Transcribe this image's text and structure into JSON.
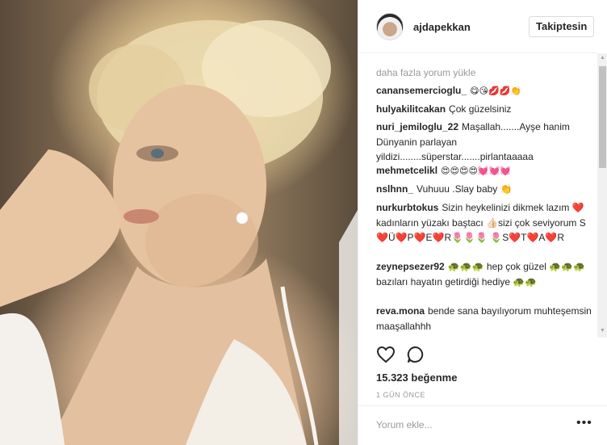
{
  "post": {
    "username": "ajdapekkan",
    "follow_label": "Takiptesin",
    "load_more": "daha fazla yorum yükle",
    "comments": [
      {
        "user": "canansemercioglu_",
        "text": "😋😘💋💋👏"
      },
      {
        "user": "hulyakilitcakan",
        "text": "Çok güzelsiniz"
      },
      {
        "user": "nuri_jemiloglu_22",
        "text": "Maşallah.......Ayşe hanim Dünyanin parlayan yildizi........süperstar.......pirlantaaaaa"
      },
      {
        "user": "mehmetcelikl",
        "text": "😍😍😍😍💓💓💓"
      },
      {
        "user": "nslhnn_",
        "text": "Vuhuuu .Slay baby 👏"
      },
      {
        "user": "nurkurbtokus",
        "text": "Sizin heykelinizi dikmek lazım ❤️ kadınların yüzakı baştacı 👍🏻sizi çok seviyorum S❤️Ü❤️P❤️E❤️R🌷🌷🌷 🌷S❤️T❤️A❤️R"
      },
      {
        "user": "zeynepsezer92",
        "text": "🐢🐢🐢 hep çok güzel 🐢🐢🐢 bazıları hayatın getirdiği hediye 🐢🐢"
      },
      {
        "user": "reva.mona",
        "text": "bende sana bayılıyorum muhteşemsin maaşallahhh"
      }
    ],
    "likes": "15.323 beğenme",
    "time": "1 GÜN ÖNCE",
    "add_comment_placeholder": "Yorum ekle...",
    "more_options": "•••"
  },
  "icons": {
    "like": "heart-icon",
    "comment": "comment-bubble-icon",
    "options": "more-options-icon"
  }
}
